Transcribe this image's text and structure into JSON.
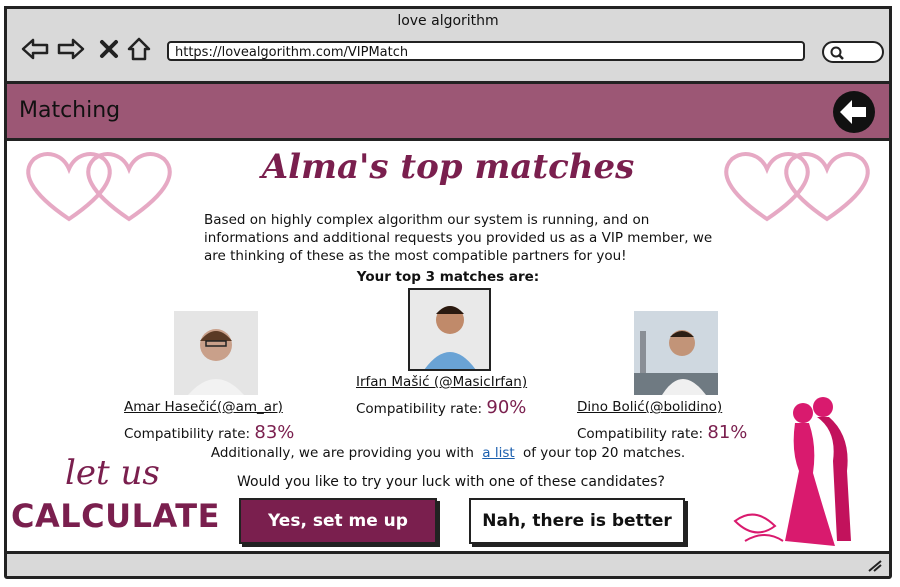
{
  "window": {
    "title": "love algorithm"
  },
  "browser": {
    "url": "https://lovealgorithm.com/VIPMatch"
  },
  "appbar": {
    "title": "Matching"
  },
  "page": {
    "heading": "Alma's top matches",
    "intro": "Based on highly complex algorithm our system is running, and on informations and additional requests you provided us as a VIP member, we are thinking of these as the most compatible partners for you!",
    "top3_label": "Your top 3 matches are:",
    "rate_label": "Compatibility rate:"
  },
  "matches": [
    {
      "name": "Amar Hasečić(@am_ar)",
      "rate": "83%"
    },
    {
      "name": "Irfan Mašić (@MasicIrfan)",
      "rate": "90%"
    },
    {
      "name": "Dino Bolić(@bolidino)",
      "rate": "81%"
    }
  ],
  "additional": {
    "before": "Additionally, we are providing you with",
    "link": "a list",
    "after": "of your top 20 matches."
  },
  "question": "Would you like to try your luck with one of these candidates?",
  "buttons": {
    "yes": "Yes, set me up",
    "no": "Nah, there is better"
  },
  "promo": {
    "line1": "let us",
    "line2": "CALCULATE"
  },
  "icons": [
    "back-arrow-icon",
    "forward-arrow-icon",
    "close-icon",
    "home-icon",
    "search-icon",
    "back-circle-icon",
    "heart-icon",
    "resize-grip-icon"
  ],
  "colors": {
    "accent": "#7a1f4e",
    "appbar": "#9c5775",
    "heart": "#e6a9c4",
    "chrome": "#d9d9d9"
  }
}
